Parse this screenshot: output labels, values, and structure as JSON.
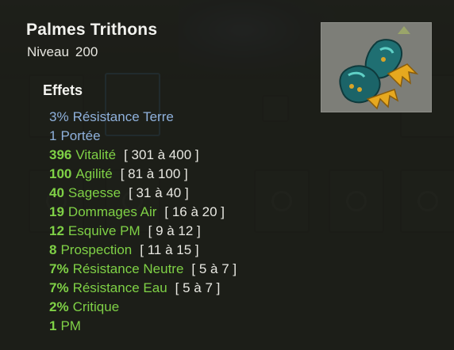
{
  "item": {
    "name": "Palmes Trithons",
    "level_label": "Niveau",
    "level": "200",
    "image_icon": "flippers-icon"
  },
  "effects": {
    "title": "Effets",
    "list": [
      {
        "value": "3%",
        "label": "Résistance Terre",
        "range": "",
        "color": "#8fb1dc"
      },
      {
        "value": "1",
        "label": "Portée",
        "range": "",
        "color": "#8fb1dc"
      },
      {
        "value": "396",
        "label": "Vitalité",
        "range": "[ 301 à 400 ]",
        "color": "#7fd146"
      },
      {
        "value": "100",
        "label": "Agilité",
        "range": "[ 81 à 100 ]",
        "color": "#7fd146"
      },
      {
        "value": "40",
        "label": "Sagesse",
        "range": "[ 31 à 40 ]",
        "color": "#7fd146"
      },
      {
        "value": "19",
        "label": "Dommages Air",
        "range": "[ 16 à 20 ]",
        "color": "#7fd146"
      },
      {
        "value": "12",
        "label": "Esquive PM",
        "range": "[ 9 à 12 ]",
        "color": "#7fd146"
      },
      {
        "value": "8",
        "label": "Prospection",
        "range": "[ 11 à 15 ]",
        "color": "#7fd146"
      },
      {
        "value": "7%",
        "label": "Résistance Neutre",
        "range": "[ 5 à 7 ]",
        "color": "#7fd146"
      },
      {
        "value": "7%",
        "label": "Résistance Eau",
        "range": "[ 5 à 7 ]",
        "color": "#7fd146"
      },
      {
        "value": "2%",
        "label": "Critique",
        "range": "",
        "color": "#7fd146"
      },
      {
        "value": "1",
        "label": "PM",
        "range": "",
        "color": "#7fd146"
      }
    ]
  }
}
